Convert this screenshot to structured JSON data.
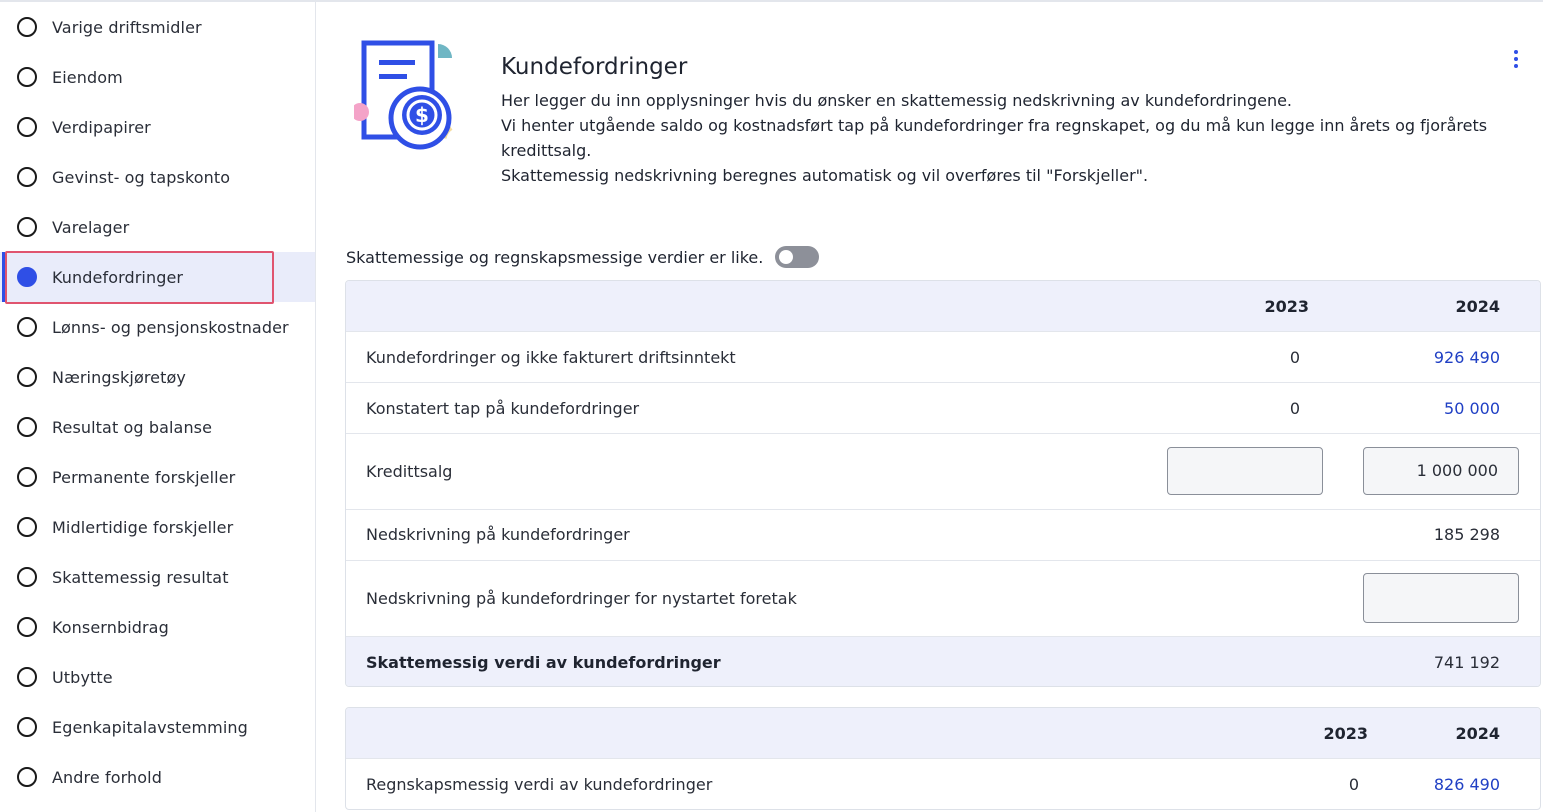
{
  "sidebar": {
    "items": [
      {
        "label": "Varige driftsmidler"
      },
      {
        "label": "Eiendom"
      },
      {
        "label": "Verdipapirer"
      },
      {
        "label": "Gevinst- og tapskonto"
      },
      {
        "label": "Varelager"
      },
      {
        "label": "Kundefordringer",
        "active": true
      },
      {
        "label": "Lønns- og pensjonskostnader"
      },
      {
        "label": "Næringskjøretøy"
      },
      {
        "label": "Resultat og balanse"
      },
      {
        "label": "Permanente forskjeller"
      },
      {
        "label": "Midlertidige forskjeller"
      },
      {
        "label": "Skattemessig resultat"
      },
      {
        "label": "Konsernbidrag"
      },
      {
        "label": "Utbytte"
      },
      {
        "label": "Egenkapitalavstemming"
      },
      {
        "label": "Andre forhold"
      }
    ]
  },
  "header": {
    "title": "Kundefordringer",
    "desc1": "Her legger du inn opplysninger hvis du ønsker en skattemessig nedskrivning av kundefordringene.",
    "desc2": "Vi henter utgående saldo og kostnadsført tap på kundefordringer fra regnskapet, og du må kun legge inn årets og fjorårets kredittsalg.",
    "desc3": "Skattemessig nedskrivning beregnes automatisk og vil overføres til \"Forskjeller\"."
  },
  "toggle": {
    "label": "Skattemessige og regnskapsmessige verdier er like.",
    "on": false
  },
  "table1": {
    "col_2023": "2023",
    "col_2024": "2024",
    "rows": [
      {
        "label": "Kundefordringer og ikke fakturert driftsinntekt",
        "v2023": "0",
        "v2024": "926 490"
      },
      {
        "label": "Konstatert tap på kundefordringer",
        "v2023": "0",
        "v2024": "50 000"
      },
      {
        "label": "Kredittsalg",
        "v2023": "",
        "v2024": "1 000 000"
      },
      {
        "label": "Nedskrivning på kundefordringer",
        "v2024": "185 298"
      },
      {
        "label": "Nedskrivning på kundefordringer for nystartet foretak",
        "v2024": ""
      },
      {
        "label": "Skattemessig verdi av kundefordringer",
        "v2024": "741 192"
      }
    ]
  },
  "table2": {
    "col_2023": "2023",
    "col_2024": "2024",
    "rows": [
      {
        "label": "Regnskapsmessig verdi av kundefordringer",
        "v2023": "0",
        "v2024": "826 490"
      }
    ]
  },
  "colors": {
    "accent": "#2f4fe6",
    "link": "#1f3fc4",
    "highlight": "#e0546f"
  },
  "icons": [
    "radio-icon",
    "document-coin-icon",
    "more-vertical-icon"
  ]
}
